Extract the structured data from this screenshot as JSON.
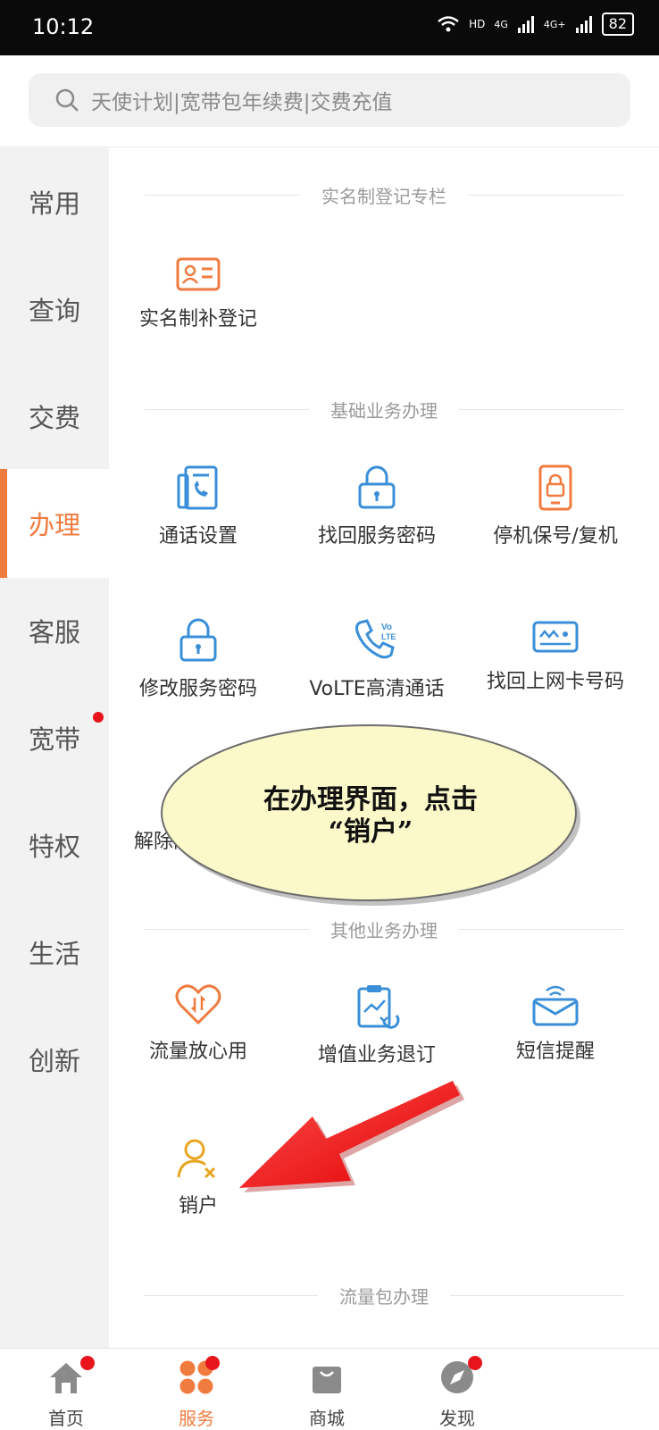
{
  "status": {
    "time": "10:12",
    "net1": "4G",
    "net2": "4G+",
    "hd": "HD",
    "battery": "82"
  },
  "search": {
    "placeholder": "天使计划|宽带包年续费|交费充值"
  },
  "sidebar": {
    "items": [
      {
        "label": "常用"
      },
      {
        "label": "查询"
      },
      {
        "label": "交费"
      },
      {
        "label": "办理",
        "active": true
      },
      {
        "label": "客服"
      },
      {
        "label": "宽带",
        "dot": true
      },
      {
        "label": "特权"
      },
      {
        "label": "生活"
      },
      {
        "label": "创新"
      }
    ]
  },
  "sections": [
    {
      "title": "实名制登记专栏",
      "items": [
        {
          "label": "实名制补登记",
          "icon": "id-card-icon"
        }
      ]
    },
    {
      "title": "基础业务办理",
      "items": [
        {
          "label": "通话设置",
          "icon": "call-settings-icon"
        },
        {
          "label": "找回服务密码",
          "icon": "lock-icon"
        },
        {
          "label": "停机保号/复机",
          "icon": "phone-lock-icon"
        },
        {
          "label": "修改服务密码",
          "icon": "lock-icon"
        },
        {
          "label": "VoLTE高清通话",
          "icon": "volte-phone-icon"
        },
        {
          "label": "找回上网卡号码",
          "icon": "sim-card-icon"
        },
        {
          "label": "解除限",
          "icon": "unlock-icon"
        }
      ]
    },
    {
      "title": "其他业务办理",
      "items": [
        {
          "label": "流量放心用",
          "icon": "heart-data-icon"
        },
        {
          "label": "增值业务退订",
          "icon": "clipboard-chart-icon"
        },
        {
          "label": "短信提醒",
          "icon": "message-envelope-icon"
        },
        {
          "label": "销户",
          "icon": "user-remove-icon"
        }
      ]
    },
    {
      "title": "流量包办理",
      "items": []
    }
  ],
  "callout": {
    "line1": "在办理界面，点击",
    "line2": "“销户”"
  },
  "tabbar": {
    "items": [
      {
        "label": "首页",
        "icon": "home-icon",
        "dot": true
      },
      {
        "label": "服务",
        "icon": "service-grid-icon",
        "dot": true,
        "active": true
      },
      {
        "label": "商城",
        "icon": "shopping-bag-icon"
      },
      {
        "label": "发现",
        "icon": "compass-icon",
        "dot": true
      }
    ]
  },
  "colors": {
    "accent": "#f07b3f",
    "blue": "#3a8fd8",
    "yellow": "#e7a521",
    "badge": "#e8141b",
    "callout": "#fbf8c9",
    "arrow": "#ff1010"
  }
}
